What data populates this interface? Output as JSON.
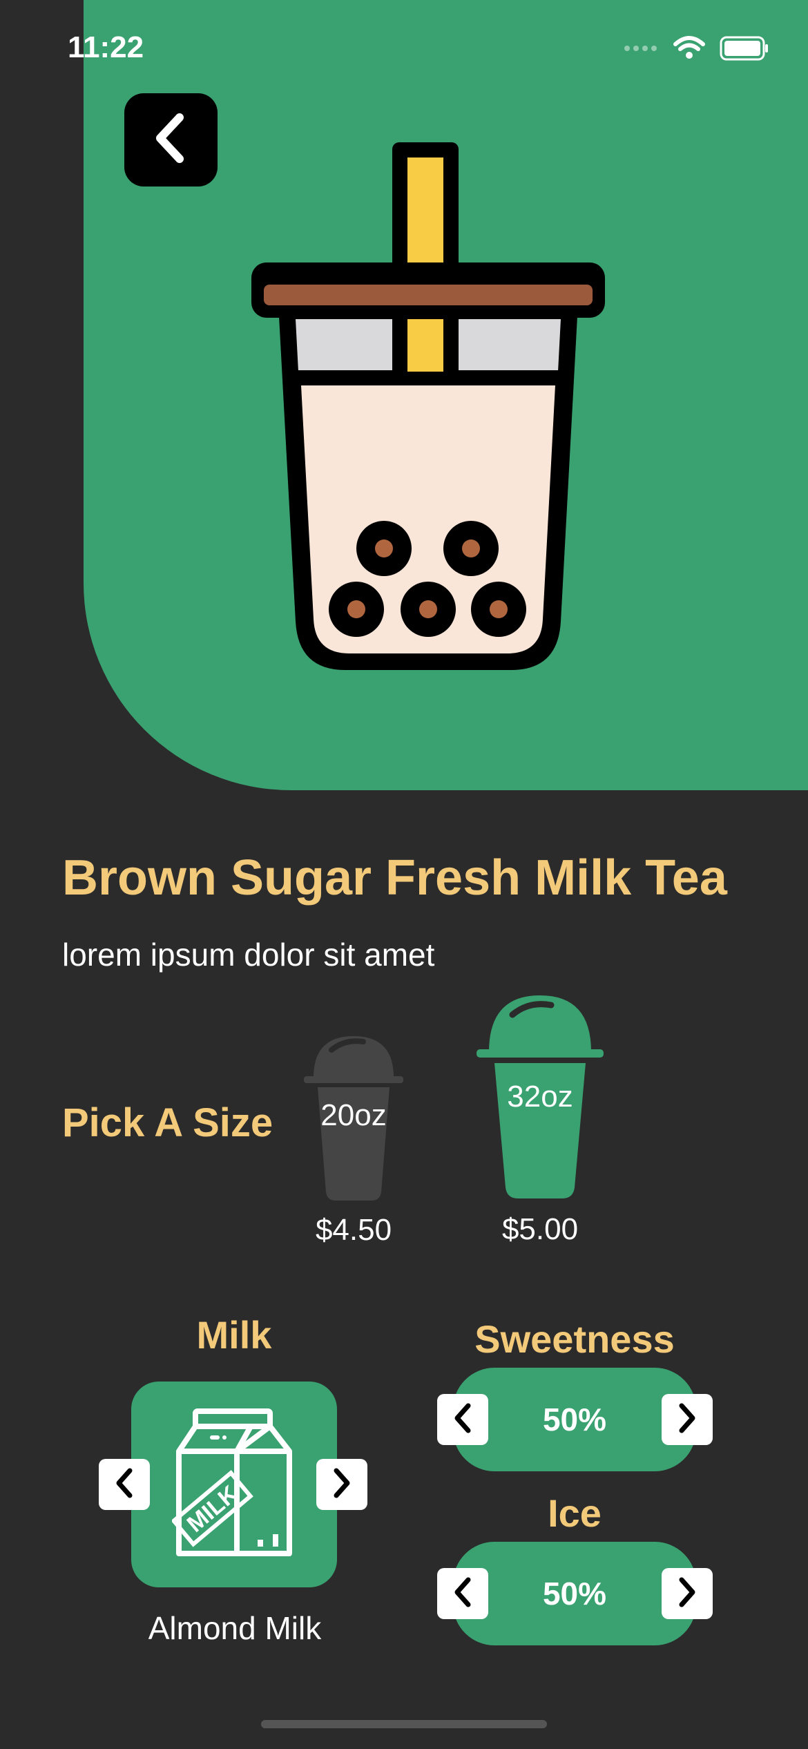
{
  "status": {
    "time": "11:22"
  },
  "product": {
    "title": "Brown Sugar Fresh Milk Tea",
    "description": "lorem ipsum dolor sit amet"
  },
  "size": {
    "label": "Pick A Size",
    "options": [
      {
        "size": "20oz",
        "price": "$4.50",
        "selected": false
      },
      {
        "size": "32oz",
        "price": "$5.00",
        "selected": true
      }
    ]
  },
  "milk": {
    "label": "Milk",
    "value": "Almond Milk",
    "icon": "milk-carton-icon",
    "icon_text": "MILK"
  },
  "sweetness": {
    "label": "Sweetness",
    "value": "50%"
  },
  "ice": {
    "label": "Ice",
    "value": "50%"
  },
  "colors": {
    "accent_green": "#3aa271",
    "title_yellow": "#f3c97a",
    "background": "#2b2b2b"
  }
}
